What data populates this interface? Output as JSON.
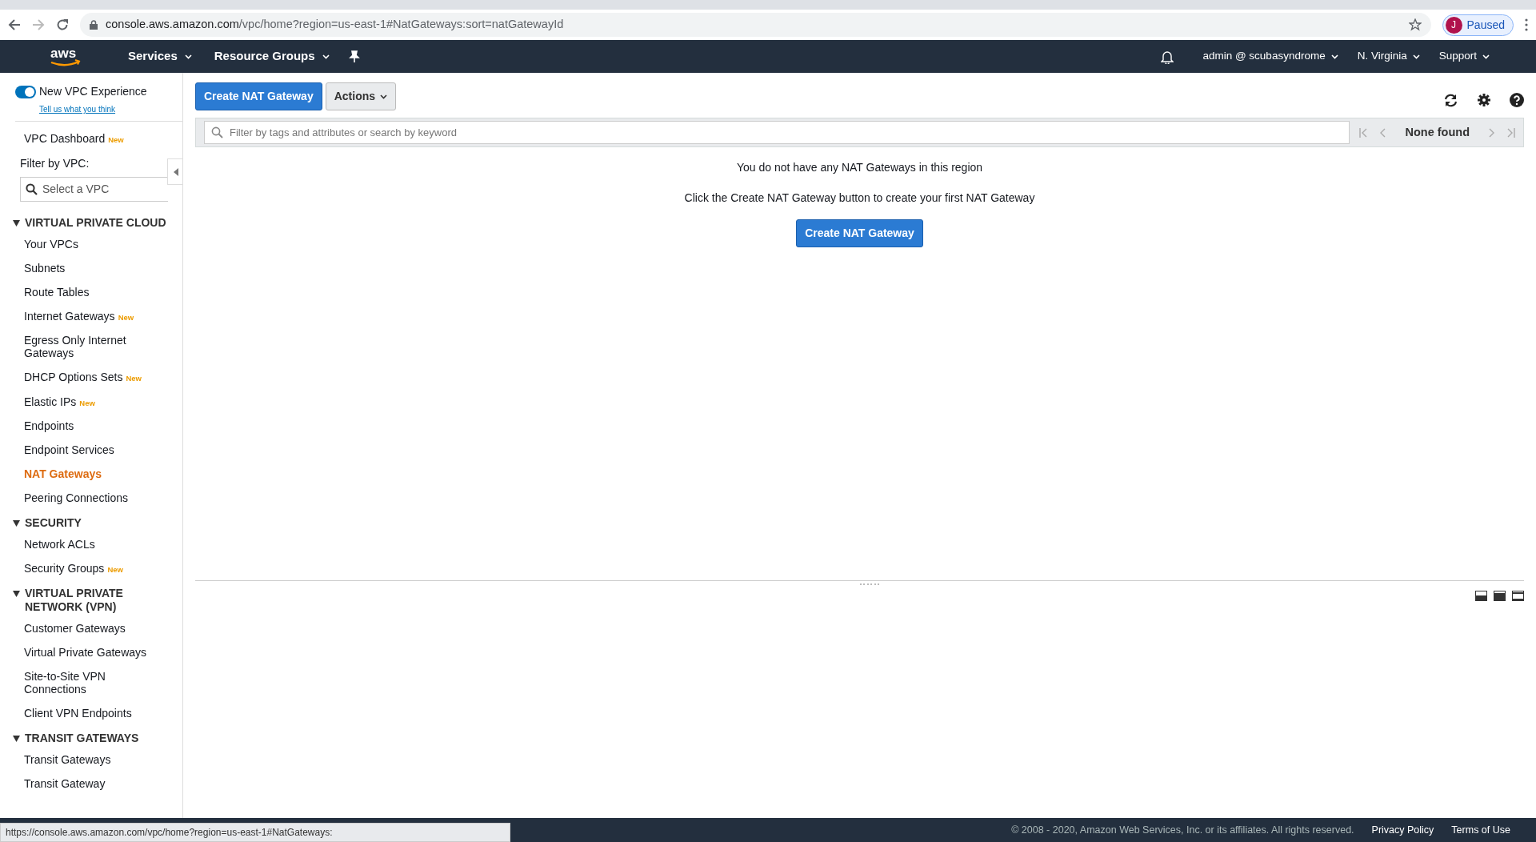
{
  "browser": {
    "url_host": "console.aws.amazon.com",
    "url_path": "/vpc/home?region=us-east-1#NatGateways:sort=natGatewayId",
    "profile_initial": "J",
    "profile_status": "Paused"
  },
  "topnav": {
    "logo": "aws",
    "left": [
      {
        "label": "Services"
      },
      {
        "label": "Resource Groups"
      }
    ],
    "right": [
      {
        "label": "admin @ scubasyndrome"
      },
      {
        "label": "N. Virginia"
      },
      {
        "label": "Support"
      }
    ]
  },
  "sidebar": {
    "toggle": {
      "label": "New VPC Experience",
      "on": true
    },
    "feedback_link": "Tell us what you think",
    "top_links": [
      {
        "label": "VPC Dashboard",
        "badge": "New",
        "selected": false
      }
    ],
    "filter": {
      "label": "Filter by VPC:",
      "placeholder": "Select a VPC"
    },
    "sections": [
      {
        "title": "VIRTUAL PRIVATE CLOUD",
        "expanded": true,
        "items": [
          {
            "label": "Your VPCs",
            "selected": false
          },
          {
            "label": "Subnets",
            "selected": false
          },
          {
            "label": "Route Tables",
            "selected": false
          },
          {
            "label": "Internet Gateways",
            "badge": "New",
            "selected": false
          },
          {
            "label": "Egress Only Internet Gateways",
            "selected": false
          },
          {
            "label": "DHCP Options Sets",
            "badge": "New",
            "selected": false
          },
          {
            "label": "Elastic IPs",
            "badge": "New",
            "selected": false
          },
          {
            "label": "Endpoints",
            "selected": false
          },
          {
            "label": "Endpoint Services",
            "selected": false
          },
          {
            "label": "NAT Gateways",
            "selected": true
          },
          {
            "label": "Peering Connections",
            "selected": false
          }
        ]
      },
      {
        "title": "SECURITY",
        "expanded": true,
        "items": [
          {
            "label": "Network ACLs",
            "selected": false
          },
          {
            "label": "Security Groups",
            "badge": "New",
            "selected": false
          }
        ]
      },
      {
        "title": "VIRTUAL PRIVATE NETWORK (VPN)",
        "expanded": true,
        "items": [
          {
            "label": "Customer Gateways",
            "selected": false
          },
          {
            "label": "Virtual Private Gateways",
            "selected": false
          },
          {
            "label": "Site-to-Site VPN Connections",
            "selected": false
          },
          {
            "label": "Client VPN Endpoints",
            "selected": false
          }
        ]
      },
      {
        "title": "TRANSIT GATEWAYS",
        "expanded": true,
        "items": [
          {
            "label": "Transit Gateways",
            "selected": false
          },
          {
            "label": "Transit Gateway",
            "selected": false
          }
        ]
      }
    ]
  },
  "toolbar": {
    "create_button": "Create NAT Gateway",
    "actions_button": "Actions"
  },
  "filter_bar": {
    "placeholder": "Filter by tags and attributes or search by keyword",
    "pagination": "None found"
  },
  "empty_state": {
    "message": "You do not have any NAT Gateways in this region",
    "hint": "Click the Create NAT Gateway button to create your first NAT Gateway",
    "button": "Create NAT Gateway"
  },
  "footer": {
    "copyright": "© 2008 - 2020, Amazon Web Services, Inc. or its affiliates. All rights reserved.",
    "links": [
      "Privacy Policy",
      "Terms of Use"
    ]
  },
  "status_url": "https://console.aws.amazon.com/vpc/home?region=us-east-1#NatGateways:"
}
